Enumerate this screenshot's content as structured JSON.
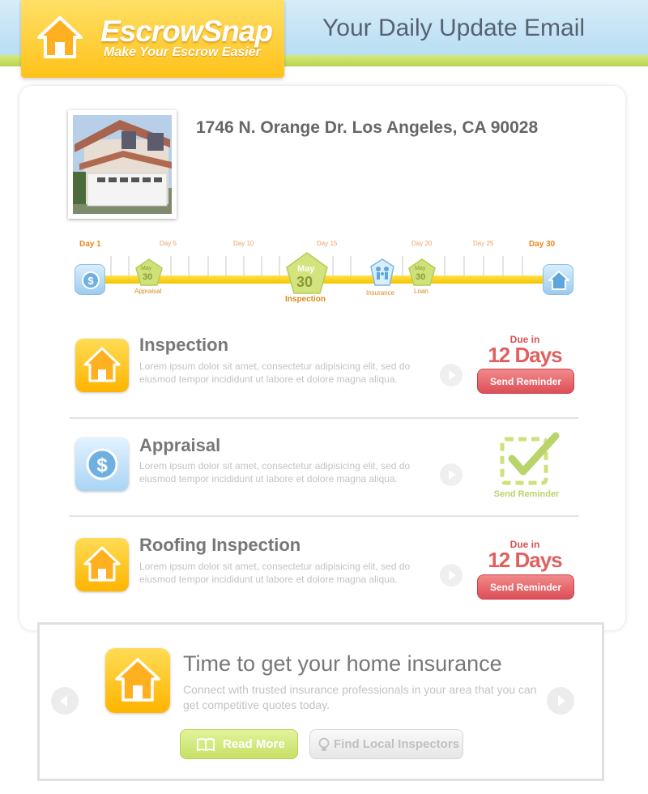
{
  "header": {
    "logo_title": "EscrowSnap",
    "logo_tagline": "Make Your Escrow Easier",
    "title": "Your Daily Update Email",
    "colors": {
      "brand_orange": "#ffc21a",
      "header_blue": "#c6e4f6",
      "accent_green": "#c6e066"
    }
  },
  "property": {
    "address": "1746 N. Orange Dr. Los Angeles, CA 90028",
    "photo_icon": "house-photo"
  },
  "timeline": {
    "day_labels": [
      "Day 1",
      "Day 5",
      "Day 10",
      "Day 15",
      "Day 20",
      "Day 25",
      "Day 30"
    ],
    "markers": {
      "appraisal": {
        "month": "May",
        "day": "30",
        "label": "Appraisal"
      },
      "inspection": {
        "month": "May",
        "day": "30",
        "label": "Inspection"
      },
      "insurance": {
        "label": "Insurance",
        "icon": "family-shield-icon"
      },
      "loan": {
        "month": "May",
        "day": "30",
        "label": "Loan"
      }
    },
    "start_icon": "dollar-coin-icon",
    "end_icon": "home-icon"
  },
  "tasks": [
    {
      "title": "Inspection",
      "description": "Lorem ipsum dolor sit amet, consectetur adipisicing elit, sed do eiusmod tempor incididunt ut labore et dolore magna aliqua.",
      "due_prefix": "Due in",
      "due_value": "12 Days",
      "button": "Send Reminder",
      "icon": "home-icon",
      "status": "pending"
    },
    {
      "title": "Appraisal",
      "description": "Lorem ipsum dolor sit amet, consectetur adipisicing elit, sed do eiusmod tempor incididunt ut labore et dolore magna aliqua.",
      "button": "Send Reminder",
      "icon": "dollar-coin-icon",
      "status": "done"
    },
    {
      "title": "Roofing Inspection",
      "description": "Lorem ipsum dolor sit amet, consectetur adipisicing elit, sed do eiusmod tempor incididunt ut labore et dolore magna aliqua.",
      "due_prefix": "Due in",
      "due_value": "12 Days",
      "button": "Send Reminder",
      "icon": "home-icon",
      "status": "pending"
    }
  ],
  "promo": {
    "title": "Time to get your home insurance",
    "description": "Connect with trusted insurance professionals in your area that you can get competitive quotes today.",
    "read_more": "Read More",
    "find_inspectors": "Find Local Inspectors"
  }
}
